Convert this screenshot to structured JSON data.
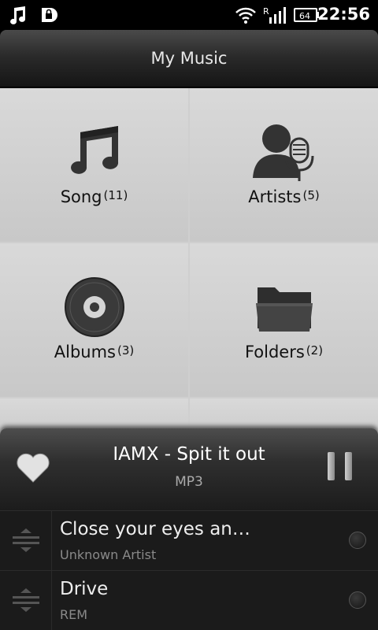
{
  "status": {
    "time": "22:56",
    "battery": "64",
    "icons": [
      "music-note-icon",
      "lock-icon",
      "wifi-icon",
      "signal-icon",
      "battery-icon"
    ]
  },
  "header": {
    "title": "My Music"
  },
  "categories": [
    {
      "label": "Song",
      "count": "(11)",
      "icon": "music-note-icon"
    },
    {
      "label": "Artists",
      "count": "(5)",
      "icon": "artist-microphone-icon"
    },
    {
      "label": "Albums",
      "count": "(3)",
      "icon": "disc-icon"
    },
    {
      "label": "Folders",
      "count": "(2)",
      "icon": "folder-icon"
    }
  ],
  "now_playing": {
    "title": "IAMX - Spit it out",
    "format": "MP3",
    "favorite_icon": "heart-icon",
    "control_icon": "pause-icon"
  },
  "queue": [
    {
      "title": "Close your eyes an…",
      "artist": "Unknown Artist"
    },
    {
      "title": "Drive",
      "artist": "REM"
    }
  ],
  "colors": {
    "background": "#000000",
    "grid": "#d0d0d0",
    "panel": "#2a2a2a"
  }
}
